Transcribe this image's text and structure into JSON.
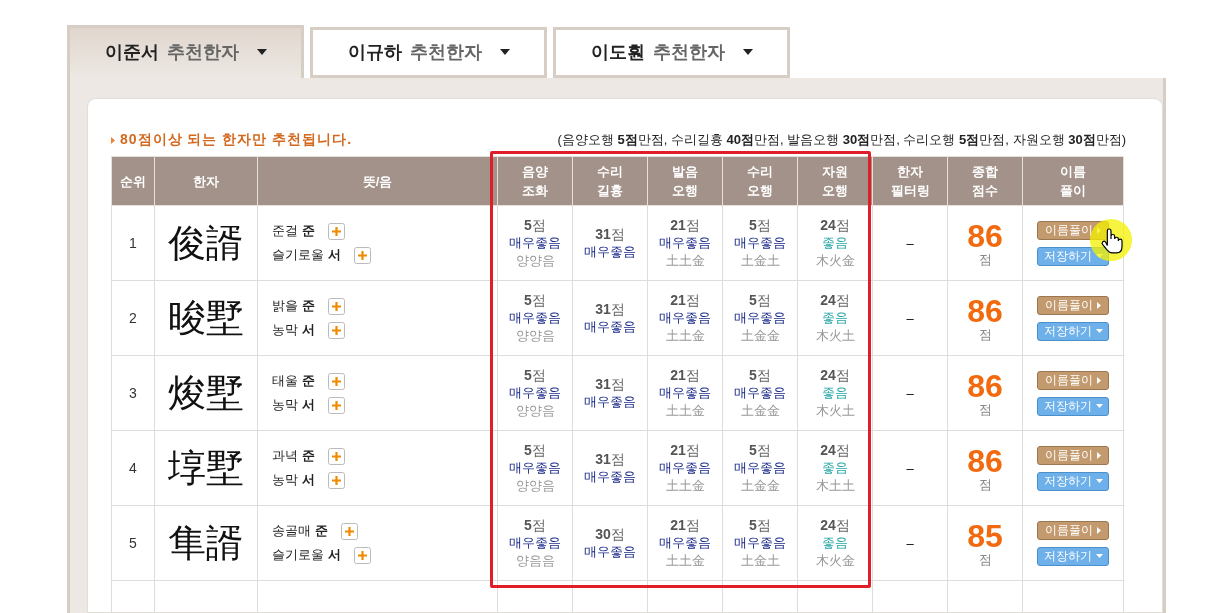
{
  "tabs": [
    {
      "name": "이준서",
      "label": "추천한자",
      "selected": true
    },
    {
      "name": "이규하",
      "label": "추천한자",
      "selected": false
    },
    {
      "name": "이도훤",
      "label": "추천한자",
      "selected": false
    }
  ],
  "notice": "80점이상 되는 한자만 추천됩니다.",
  "criteria": "(음양오행 **5점**만점, 수리길흉 **40점**만점, 발음오행 **30점**만점, 수리오행 **5점**만점, 자원오행 **30점**만점)",
  "table": {
    "columns": [
      "순위",
      "한자",
      "뜻/음",
      "음양\n조화",
      "수리\n길흉",
      "발음\n오행",
      "수리\n오행",
      "자원\n오행",
      "한자\n필터링",
      "종합\n점수",
      "이름\n풀이"
    ],
    "rows": [
      {
        "rank": "1",
        "hanja": "俊諝",
        "meanings": [
          {
            "text": "준걸",
            "sound": "준"
          },
          {
            "text": "슬기로울",
            "sound": "서"
          }
        ],
        "scores": [
          {
            "points": "5",
            "unit": "점",
            "rating": "매우좋음",
            "kind": "very_good",
            "elements": "양양음"
          },
          {
            "points": "31",
            "unit": "점",
            "rating": "매우좋음",
            "kind": "very_good"
          },
          {
            "points": "21",
            "unit": "점",
            "rating": "매우좋음",
            "kind": "very_good",
            "elements": "土土金"
          },
          {
            "points": "5",
            "unit": "점",
            "rating": "매우좋음",
            "kind": "very_good",
            "elements": "土金土"
          },
          {
            "points": "24",
            "unit": "점",
            "rating": "좋음",
            "kind": "good",
            "elements": "木火金"
          }
        ],
        "filter": "–",
        "total": "86",
        "total_unit": "점",
        "buttons": [
          "이름풀이",
          "저장하기"
        ]
      },
      {
        "rank": "2",
        "hanja": "晙墅",
        "meanings": [
          {
            "text": "밝을",
            "sound": "준"
          },
          {
            "text": "농막",
            "sound": "서"
          }
        ],
        "scores": [
          {
            "points": "5",
            "unit": "점",
            "rating": "매우좋음",
            "kind": "very_good",
            "elements": "양양음"
          },
          {
            "points": "31",
            "unit": "점",
            "rating": "매우좋음",
            "kind": "very_good"
          },
          {
            "points": "21",
            "unit": "점",
            "rating": "매우좋음",
            "kind": "very_good",
            "elements": "土土金"
          },
          {
            "points": "5",
            "unit": "점",
            "rating": "매우좋음",
            "kind": "very_good",
            "elements": "土金金"
          },
          {
            "points": "24",
            "unit": "점",
            "rating": "좋음",
            "kind": "good",
            "elements": "木火土"
          }
        ],
        "filter": "–",
        "total": "86",
        "total_unit": "점",
        "buttons": [
          "이름풀이",
          "저장하기"
        ]
      },
      {
        "rank": "3",
        "hanja": "焌墅",
        "meanings": [
          {
            "text": "태울",
            "sound": "준"
          },
          {
            "text": "농막",
            "sound": "서"
          }
        ],
        "scores": [
          {
            "points": "5",
            "unit": "점",
            "rating": "매우좋음",
            "kind": "very_good",
            "elements": "양양음"
          },
          {
            "points": "31",
            "unit": "점",
            "rating": "매우좋음",
            "kind": "very_good"
          },
          {
            "points": "21",
            "unit": "점",
            "rating": "매우좋음",
            "kind": "very_good",
            "elements": "土土金"
          },
          {
            "points": "5",
            "unit": "점",
            "rating": "매우좋음",
            "kind": "very_good",
            "elements": "土金金"
          },
          {
            "points": "24",
            "unit": "점",
            "rating": "좋음",
            "kind": "good",
            "elements": "木火土"
          }
        ],
        "filter": "–",
        "total": "86",
        "total_unit": "점",
        "buttons": [
          "이름풀이",
          "저장하기"
        ]
      },
      {
        "rank": "4",
        "hanja": "埻墅",
        "meanings": [
          {
            "text": "과녁",
            "sound": "준"
          },
          {
            "text": "농막",
            "sound": "서"
          }
        ],
        "scores": [
          {
            "points": "5",
            "unit": "점",
            "rating": "매우좋음",
            "kind": "very_good",
            "elements": "양양음"
          },
          {
            "points": "31",
            "unit": "점",
            "rating": "매우좋음",
            "kind": "very_good"
          },
          {
            "points": "21",
            "unit": "점",
            "rating": "매우좋음",
            "kind": "very_good",
            "elements": "土土金"
          },
          {
            "points": "5",
            "unit": "점",
            "rating": "매우좋음",
            "kind": "very_good",
            "elements": "土金金"
          },
          {
            "points": "24",
            "unit": "점",
            "rating": "좋음",
            "kind": "good",
            "elements": "木土土"
          }
        ],
        "filter": "–",
        "total": "86",
        "total_unit": "점",
        "buttons": [
          "이름풀이",
          "저장하기"
        ]
      },
      {
        "rank": "5",
        "hanja": "隼諝",
        "meanings": [
          {
            "text": "송골매",
            "sound": "준"
          },
          {
            "text": "슬기로울",
            "sound": "서"
          }
        ],
        "scores": [
          {
            "points": "5",
            "unit": "점",
            "rating": "매우좋음",
            "kind": "very_good",
            "elements": "양음음"
          },
          {
            "points": "30",
            "unit": "점",
            "rating": "매우좋음",
            "kind": "very_good"
          },
          {
            "points": "21",
            "unit": "점",
            "rating": "매우좋음",
            "kind": "very_good",
            "elements": "土土金"
          },
          {
            "points": "5",
            "unit": "점",
            "rating": "매우좋음",
            "kind": "very_good",
            "elements": "土金土"
          },
          {
            "points": "24",
            "unit": "점",
            "rating": "좋음",
            "kind": "good",
            "elements": "木火金"
          }
        ],
        "filter": "–",
        "total": "85",
        "total_unit": "점",
        "buttons": [
          "이름풀이",
          "저장하기"
        ]
      }
    ]
  }
}
